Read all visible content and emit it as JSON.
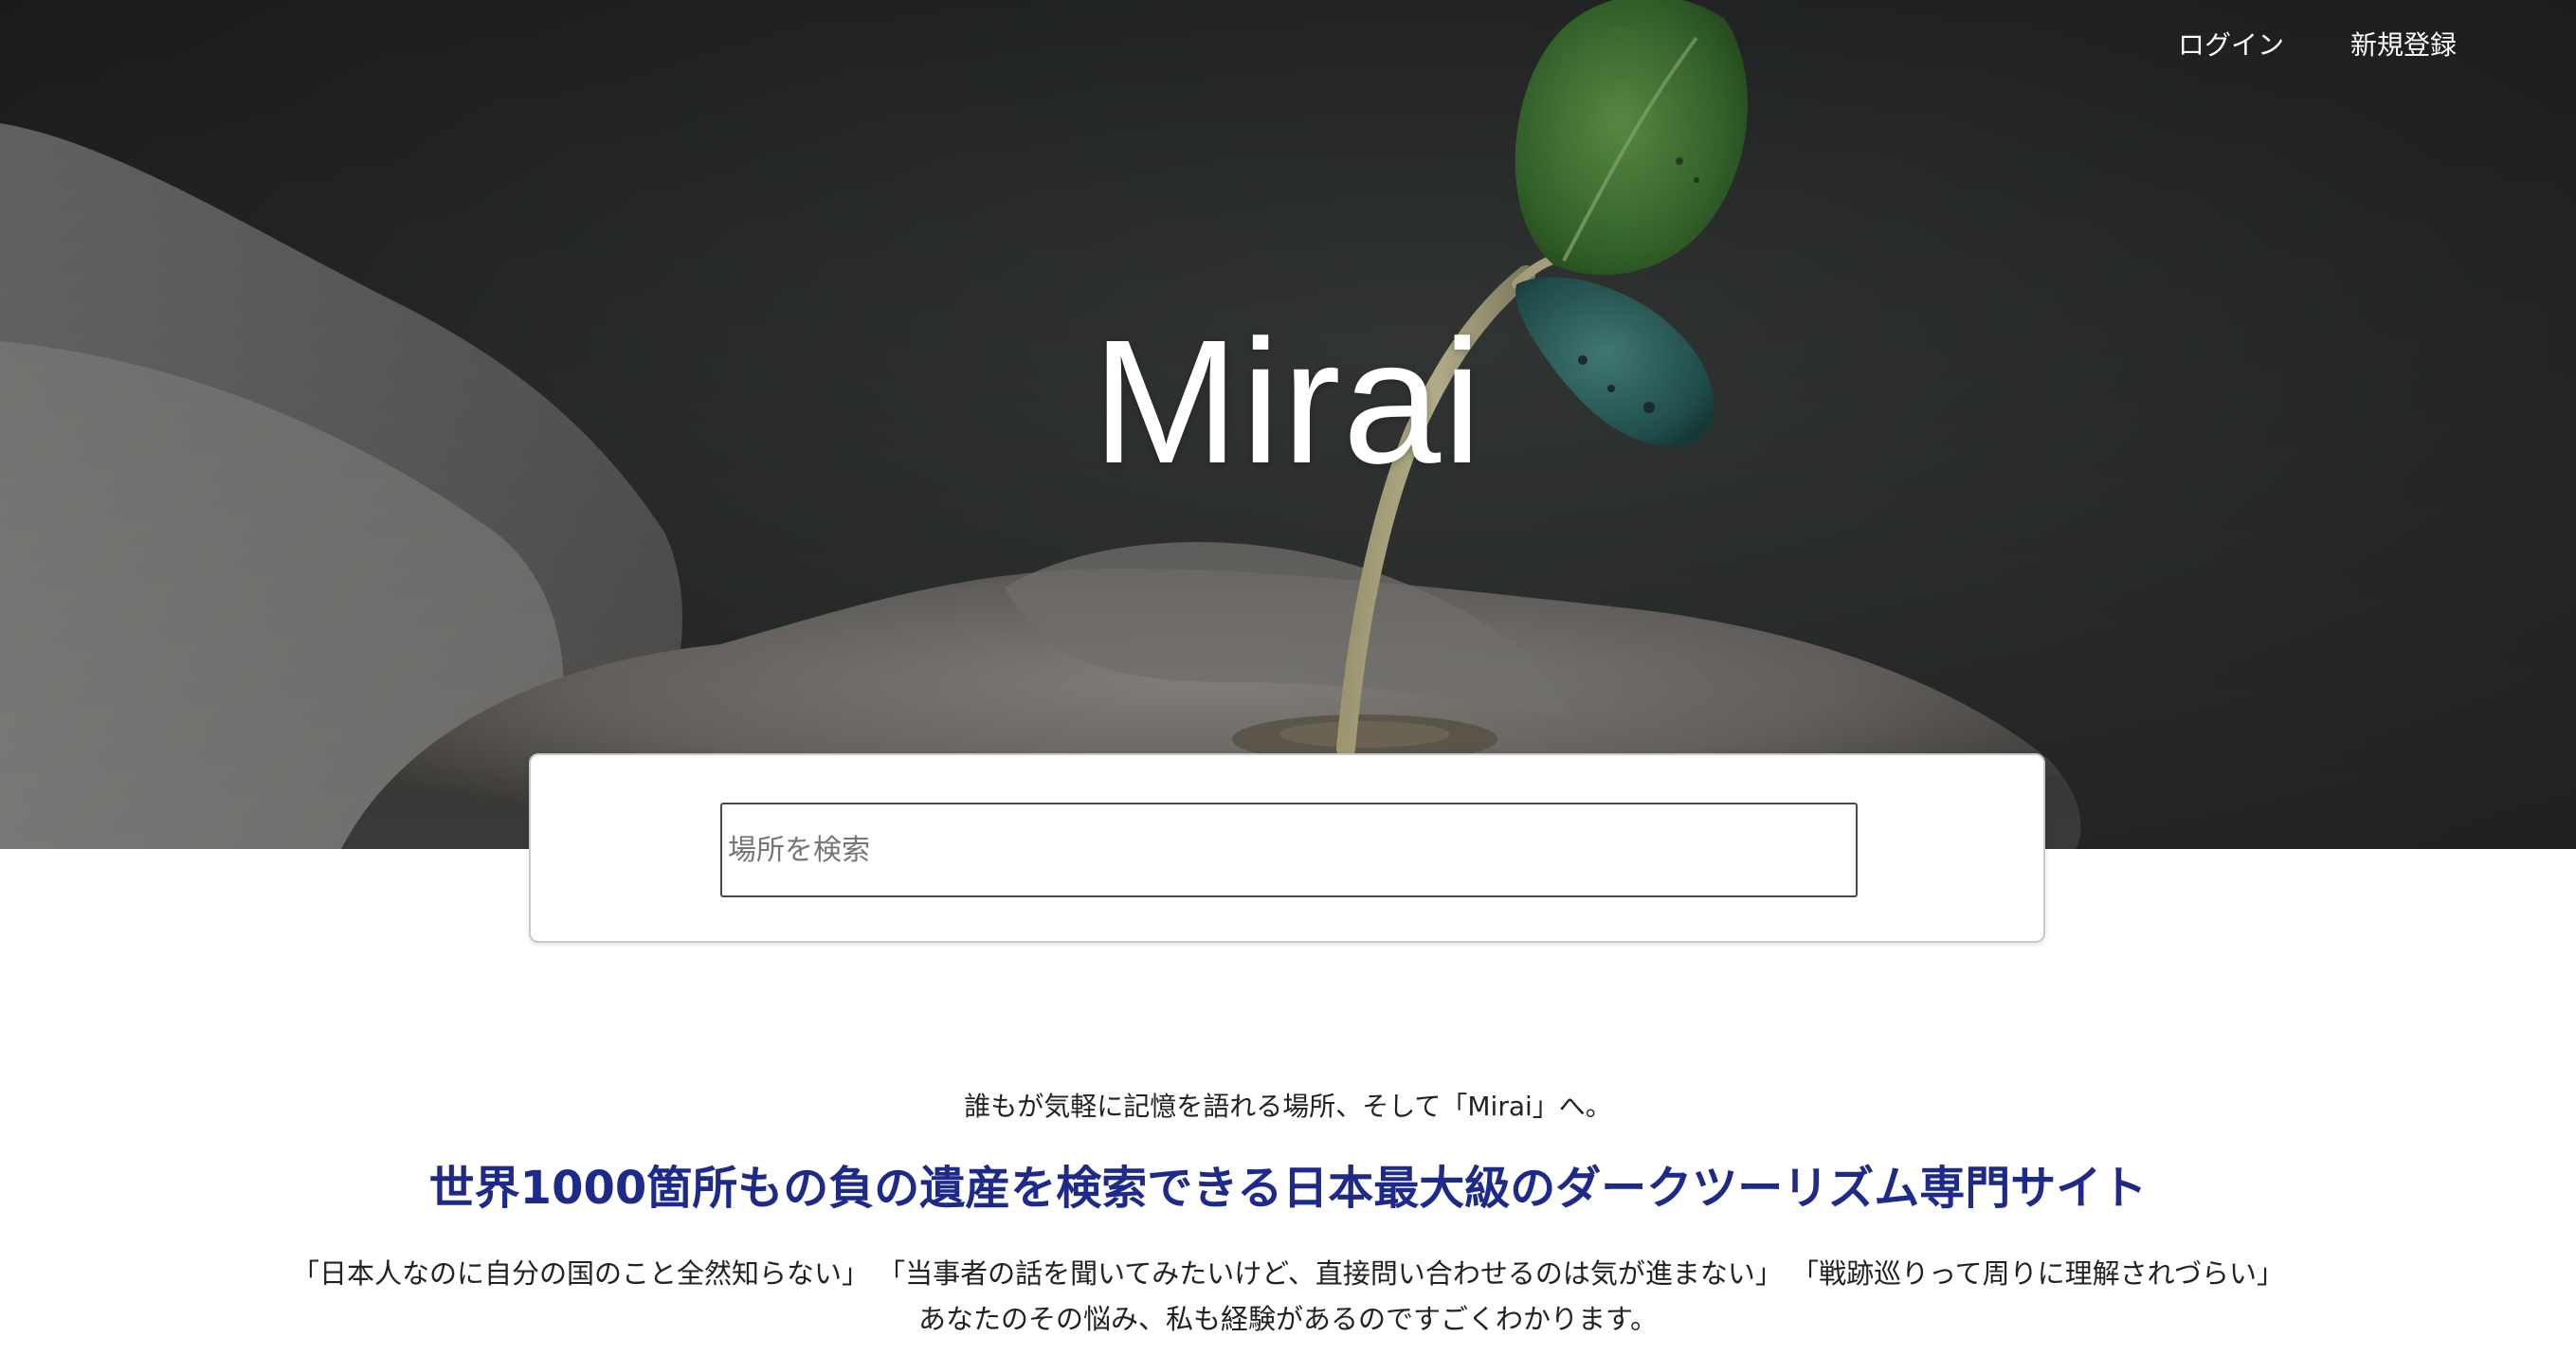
{
  "nav": {
    "login_label": "ログイン",
    "signup_label": "新規登録"
  },
  "hero": {
    "title": "Mirai",
    "image_subject": "seedling-in-hands"
  },
  "search": {
    "placeholder": "場所を検索",
    "value": ""
  },
  "intro": {
    "tagline": "誰もが気軽に記憶を語れる場所、そして「Mirai」へ。",
    "headline": "世界1000箇所もの負の遺産を検索できる日本最大級のダークツーリズム専門サイト",
    "concerns": [
      "「日本人なのに自分の国のこと全然知らない」",
      "「当事者の話を聞いてみたいけど、直接問い合わせるのは気が進まない」",
      "「戦跡巡りって周りに理解されづらい」"
    ],
    "empathy": "あなたのその悩み、私も経験があるのですごくわかります。"
  },
  "colors": {
    "headline": "#1d2a8a",
    "body_text": "#222222",
    "hero_overlay": "#2a2c2c",
    "leaf_green": "#4f8a3c",
    "leaf_teal": "#2f6a66"
  }
}
